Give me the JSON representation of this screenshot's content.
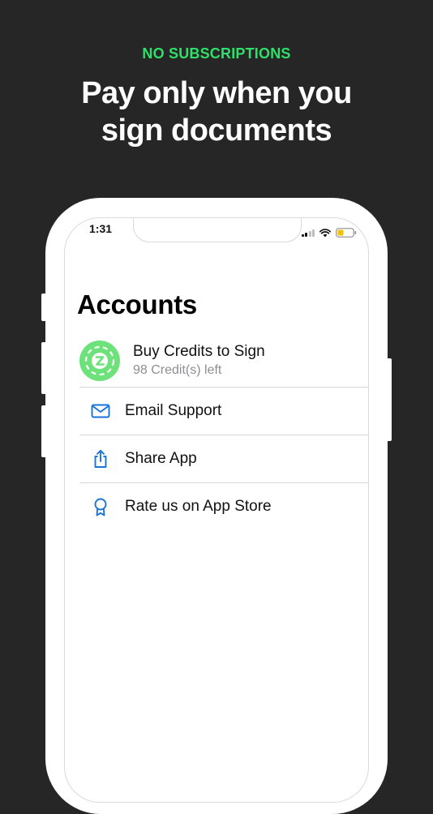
{
  "promo": {
    "eyebrow": "NO SUBSCRIPTIONS",
    "headline_line1": "Pay only when you",
    "headline_line2": "sign documents",
    "eyebrow_color": "#2ee06a",
    "background_color": "#262626"
  },
  "status_bar": {
    "time": "1:31",
    "icons": [
      "cellular-signal-icon",
      "wifi-icon",
      "battery-low-icon"
    ]
  },
  "page": {
    "title": "Accounts"
  },
  "credits": {
    "title": "Buy Credits to Sign",
    "subtitle": "98 Credit(s) left",
    "icon": "credit-coin-icon",
    "icon_color": "#6ee27a"
  },
  "menu": {
    "accent_color": "#1a73d9",
    "items": [
      {
        "label": "Email Support",
        "icon": "envelope-icon"
      },
      {
        "label": "Share App",
        "icon": "share-icon"
      },
      {
        "label": "Rate us on App Store",
        "icon": "award-ribbon-icon"
      }
    ]
  }
}
